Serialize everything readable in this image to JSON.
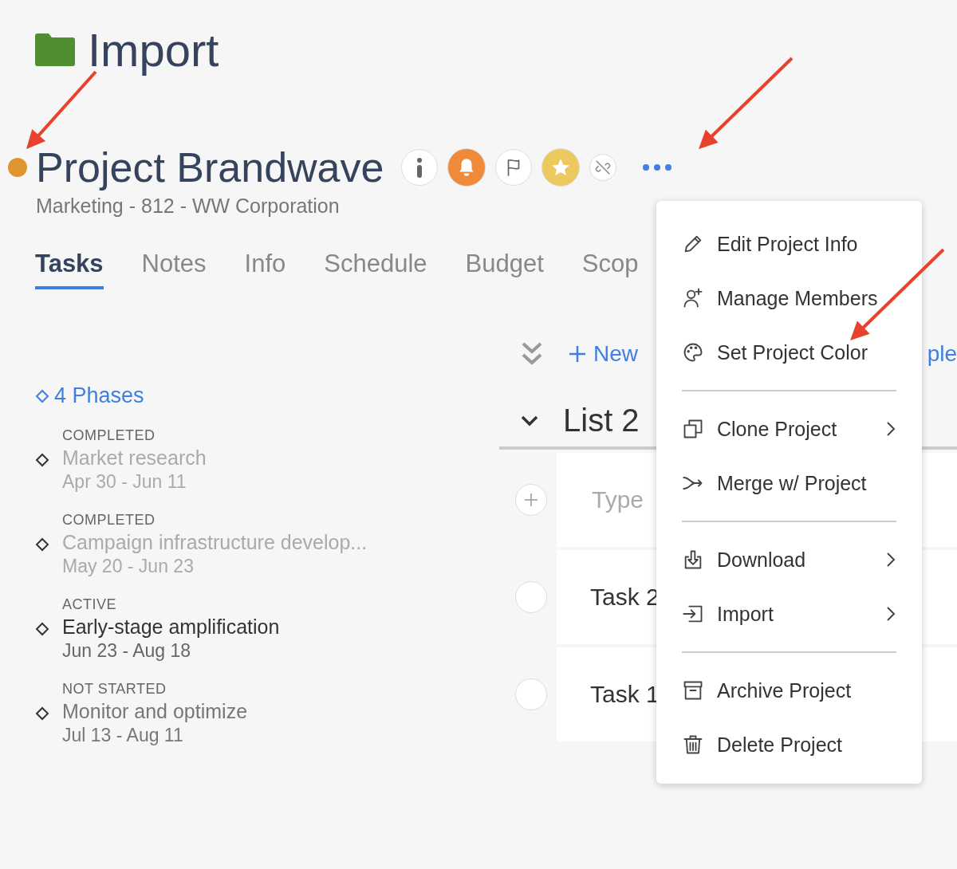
{
  "folder": {
    "title": "Import"
  },
  "project": {
    "color": "#e0962f",
    "title": "Project Brandwave",
    "subtitle": "Marketing - 812 - WW Corporation"
  },
  "actions": [
    {
      "kind": "info",
      "on": false
    },
    {
      "kind": "bell",
      "on": true
    },
    {
      "kind": "flag",
      "on": false
    },
    {
      "kind": "star",
      "on": true
    },
    {
      "kind": "link",
      "on": false
    },
    {
      "kind": "more",
      "on": false
    }
  ],
  "tabs": [
    {
      "label": "Tasks",
      "selected": true
    },
    {
      "label": "Notes",
      "selected": false
    },
    {
      "label": "Info",
      "selected": false
    },
    {
      "label": "Schedule",
      "selected": false
    },
    {
      "label": "Budget",
      "selected": false
    },
    {
      "label": "Scop",
      "selected": false
    }
  ],
  "phases": {
    "summary": "4 Phases",
    "items": [
      {
        "kind": "completed",
        "status": "COMPLETED",
        "name": "Market research",
        "dates": "Apr 30 - Jun 11"
      },
      {
        "kind": "completed",
        "status": "COMPLETED",
        "name": "Campaign infrastructure develop...",
        "dates": "May 20 - Jun 23"
      },
      {
        "kind": "active",
        "status": "ACTIVE",
        "name": "Early-stage amplification",
        "dates": "Jun 23 - Aug 18"
      },
      {
        "kind": "pending",
        "status": "NOT STARTED",
        "name": "Monitor and optimize",
        "dates": "Jul 13 - Aug 11"
      }
    ]
  },
  "toolbar": {
    "new_link": "New",
    "right_link": "ple"
  },
  "list": {
    "title": "List 2",
    "expanded": true,
    "new_task_placeholder": "Type",
    "tasks": [
      {
        "name": "Task 2",
        "checked": false
      },
      {
        "name": "Task 1",
        "checked": false
      }
    ]
  },
  "menu": {
    "groups": [
      [
        {
          "label": "Edit Project Info",
          "submenu": false
        },
        {
          "label": "Manage Members",
          "submenu": false
        },
        {
          "label": "Set Project Color",
          "submenu": false
        }
      ],
      [
        {
          "label": "Clone Project",
          "submenu": true
        },
        {
          "label": "Merge w/ Project",
          "submenu": false
        }
      ],
      [
        {
          "label": "Download",
          "submenu": true
        },
        {
          "label": "Import",
          "submenu": true
        }
      ],
      [
        {
          "label": "Archive Project",
          "submenu": false
        },
        {
          "label": "Delete Project",
          "submenu": false
        }
      ]
    ]
  }
}
